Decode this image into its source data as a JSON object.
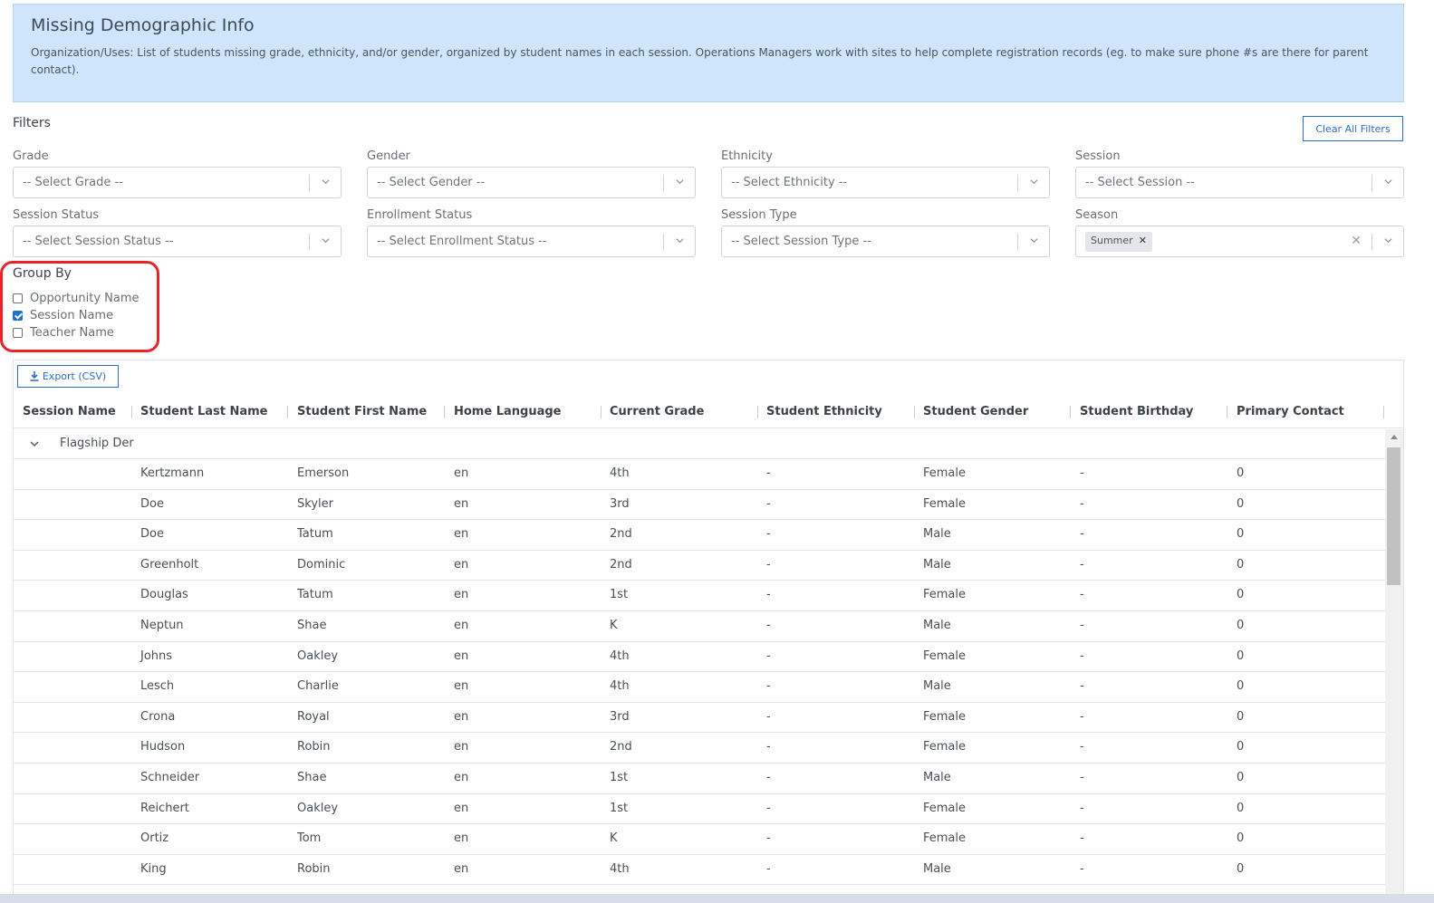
{
  "banner": {
    "title": "Missing Demographic Info",
    "description": "Organization/Uses: List of students missing grade, ethnicity, and/or gender, organized by student names in each session. Operations Managers work with sites to help complete registration records (eg. to make sure phone #s are there for parent contact)."
  },
  "filters": {
    "title": "Filters",
    "clear_label": "Clear All Filters",
    "grade": {
      "label": "Grade",
      "placeholder": "-- Select Grade --"
    },
    "gender": {
      "label": "Gender",
      "placeholder": "-- Select Gender --"
    },
    "ethnicity": {
      "label": "Ethnicity",
      "placeholder": "-- Select Ethnicity --"
    },
    "session": {
      "label": "Session",
      "placeholder": "-- Select Session --"
    },
    "session_status": {
      "label": "Session Status",
      "placeholder": "-- Select Session Status --"
    },
    "enrollment_status": {
      "label": "Enrollment Status",
      "placeholder": "-- Select Enrollment Status --"
    },
    "session_type": {
      "label": "Session Type",
      "placeholder": "-- Select Session Type --"
    },
    "season": {
      "label": "Season",
      "selected": "Summer"
    }
  },
  "group_by": {
    "title": "Group By",
    "options": [
      {
        "label": "Opportunity Name",
        "checked": false
      },
      {
        "label": "Session Name",
        "checked": true
      },
      {
        "label": "Teacher Name",
        "checked": false
      }
    ]
  },
  "grid": {
    "export_label": "Export (CSV)",
    "columns": [
      "Session Name",
      "Student Last Name",
      "Student First Name",
      "Home Language",
      "Current Grade",
      "Student Ethnicity",
      "Student Gender",
      "Student Birthday",
      "Primary Contact"
    ],
    "group_label": "Flagship Der",
    "rows": [
      [
        "Kertzmann",
        "Emerson",
        "en",
        "4th",
        "-",
        "Female",
        "-",
        "0"
      ],
      [
        "Doe",
        "Skyler",
        "en",
        "3rd",
        "-",
        "Female",
        "-",
        "0"
      ],
      [
        "Doe",
        "Tatum",
        "en",
        "2nd",
        "-",
        "Male",
        "-",
        "0"
      ],
      [
        "Greenholt",
        "Dominic",
        "en",
        "2nd",
        "-",
        "Male",
        "-",
        "0"
      ],
      [
        "Douglas",
        "Tatum",
        "en",
        "1st",
        "-",
        "Female",
        "-",
        "0"
      ],
      [
        "Neptun",
        "Shae",
        "en",
        "K",
        "-",
        "Male",
        "-",
        "0"
      ],
      [
        "Johns",
        "Oakley",
        "en",
        "4th",
        "-",
        "Female",
        "-",
        "0"
      ],
      [
        "Lesch",
        "Charlie",
        "en",
        "4th",
        "-",
        "Male",
        "-",
        "0"
      ],
      [
        "Crona",
        "Royal",
        "en",
        "3rd",
        "-",
        "Female",
        "-",
        "0"
      ],
      [
        "Hudson",
        "Robin",
        "en",
        "2nd",
        "-",
        "Female",
        "-",
        "0"
      ],
      [
        "Schneider",
        "Shae",
        "en",
        "1st",
        "-",
        "Male",
        "-",
        "0"
      ],
      [
        "Reichert",
        "Oakley",
        "en",
        "1st",
        "-",
        "Female",
        "-",
        "0"
      ],
      [
        "Ortiz",
        "Tom",
        "en",
        "K",
        "-",
        "Female",
        "-",
        "0"
      ],
      [
        "King",
        "Robin",
        "en",
        "4th",
        "-",
        "Male",
        "-",
        "0"
      ]
    ]
  },
  "colors": {
    "accent": "#2b6cc4",
    "banner_bg": "#cfe5fb",
    "highlight": "#e8242b"
  }
}
